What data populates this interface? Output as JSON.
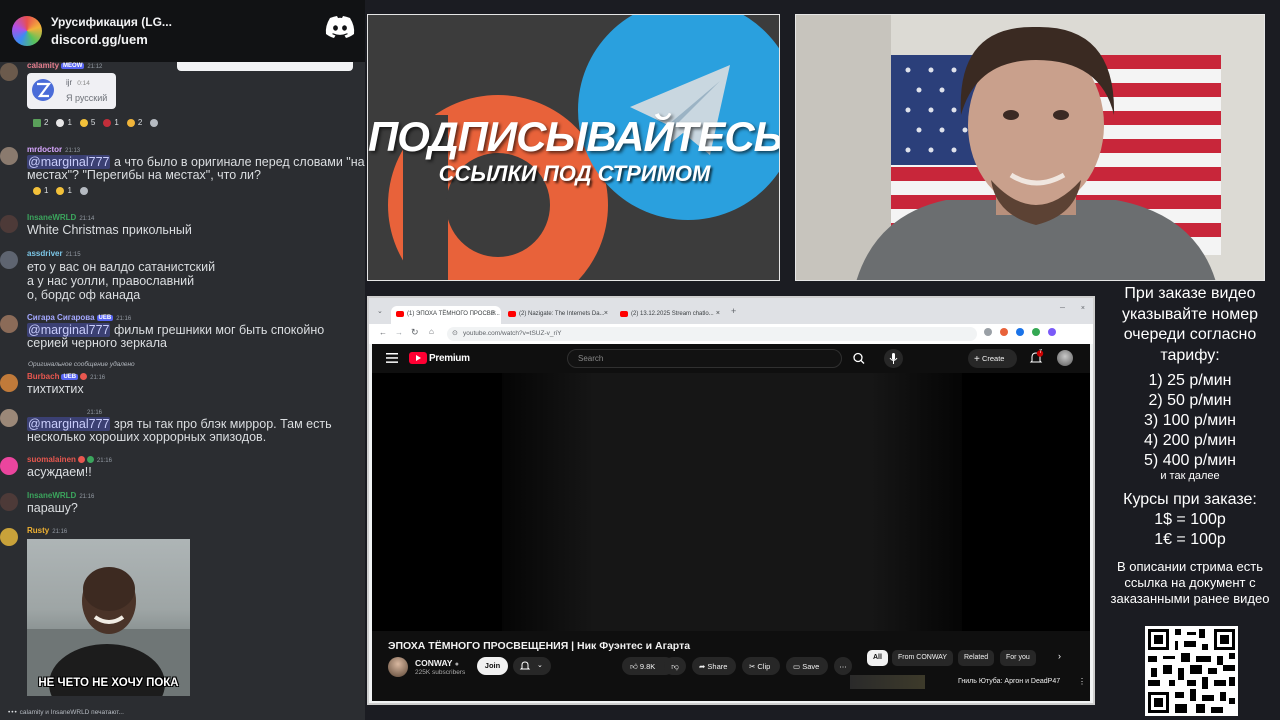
{
  "chat": {
    "server_name": "Урусификация (LG...",
    "server_link": "discord.gg/uem",
    "messages": [
      {
        "user": "calamity",
        "tag": "MEOW",
        "time": "21:12",
        "embed_user": "ijr",
        "embed_time": "0:14",
        "embed_text": "Я русский",
        "reactions": [
          "2",
          "1",
          "5",
          "1",
          "2"
        ]
      },
      {
        "user": "mrdoctor",
        "time": "21:13",
        "mention": "@marginal777",
        "text": " а что было в оригинале перед словами \"на местах\"? \"Перегибы на местах\", что ли?",
        "reactions": [
          "1",
          "1"
        ]
      },
      {
        "user": "InsaneWRLD",
        "time": "21:14",
        "text": "White Christmas прикольный"
      },
      {
        "user": "assdriver",
        "time": "21:15",
        "text": "ето у вас он валдо сатанистский\nа у нас уолли, православний\nо, бордс оф канада"
      },
      {
        "user": "Сигара Сигарова",
        "tag": "UEB",
        "time": "21:16",
        "mention": "@marginal777",
        "text": " фильм грешники мог быть спокойно серией черного зеркала"
      },
      {
        "reply_note": "Оригинальное сообщение удалено",
        "user": "Burbach",
        "tag": "UEB",
        "time": "21:16",
        "text": "тихтихтих"
      },
      {
        "user": "",
        "time": "21:16",
        "mention": "@marginal777",
        "text": " зря ты так про блэк миррор. Там есть несколько хороших хоррорных эпизодов."
      },
      {
        "user": "suomalainen",
        "time": "21:16",
        "text": "асуждаем!!"
      },
      {
        "user": "InsaneWRLD",
        "time": "21:16",
        "text": "парашу?"
      },
      {
        "user": "Rusty",
        "time": "21:16",
        "image_caption": "НЕ ЧЕТО НЕ ХОЧУ ПОКА"
      }
    ],
    "typing": "calamity и InsaneWRLD печатают..."
  },
  "promo": {
    "line1": "ПОДПИСЫВАЙТЕСЬ",
    "line2": "ССЫЛКИ ПОД СТРИМОМ"
  },
  "browser": {
    "tabs": [
      {
        "title": "(1) ЭПОХА ТЁМНОГО ПРОСВЕ..."
      },
      {
        "title": "(2) Nazigate: The Internets Da..."
      },
      {
        "title": "(2) 13.12.2025 Stream chatlo..."
      }
    ],
    "url": "youtube.com/watch?v=tSUZ-v_riY",
    "youtube": {
      "brand": "Premium",
      "search_placeholder": "Search",
      "create_label": "Create",
      "notif_count": "7",
      "video_title": "ЭПОХА ТЁМНОГО ПРОСВЕЩЕНИЯ | Ник Фуэнтес и Агарта",
      "channel_name": "CONWAY",
      "subscribers": "225K subscribers",
      "join_label": "Join",
      "likes": "9.8K",
      "share_label": "Share",
      "clip_label": "Clip",
      "save_label": "Save",
      "chips": [
        "All",
        "From CONWAY",
        "Related",
        "For you"
      ],
      "rec_title": "Гниль Ютуба: Аргон и DeadP47"
    }
  },
  "info": {
    "heading": "При заказе видео указывайте номер очереди согласно тарифу:",
    "rates": [
      "1) 25 р/мин",
      "2) 50 р/мин",
      "3) 100 р/мин",
      "4) 200 р/мин",
      "5) 400 р/мин"
    ],
    "rates_more": "и так далее",
    "courses_title": "Курсы при заказе:",
    "courses": [
      "1$ = 100р",
      "1€ = 100р"
    ],
    "description_note": "В описании стрима есть ссылка на документ с заказанными ранее видео"
  }
}
